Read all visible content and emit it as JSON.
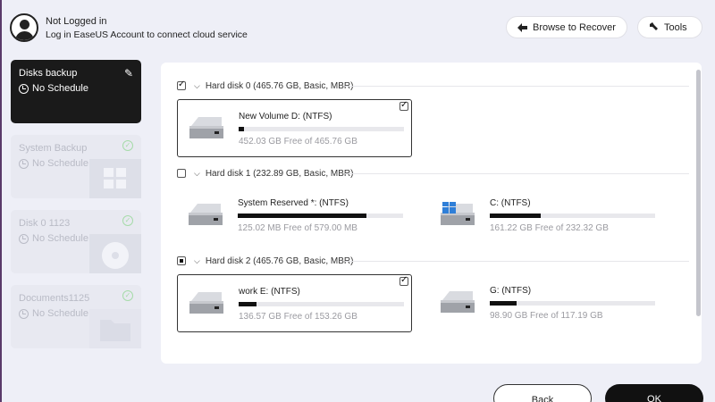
{
  "account": {
    "title": "Not Logged in",
    "subtitle": "Log in EaseUS Account to connect cloud service"
  },
  "toolbar": {
    "browse_label": "Browse to Recover",
    "tools_label": "Tools"
  },
  "sidebar": {
    "items": [
      {
        "title": "Disks backup",
        "schedule": "No Schedule",
        "active": true
      },
      {
        "title": "System Backup",
        "schedule": "No Schedule"
      },
      {
        "title": "Disk 0 1123",
        "schedule": "No Schedule"
      },
      {
        "title": "Documents1125",
        "schedule": "No Schedule"
      }
    ]
  },
  "disks": [
    {
      "label": "Hard disk 0 (465.76 GB, Basic, MBR)",
      "state": "checked",
      "partitions": [
        {
          "name": "New Volume D: (NTFS)",
          "free": "452.03 GB Free of 465.76 GB",
          "used_fraction": 0.03,
          "selected": true
        }
      ]
    },
    {
      "label": "Hard disk 1 (232.89 GB, Basic, MBR)",
      "state": "unchecked",
      "partitions": [
        {
          "name": "System Reserved *: (NTFS)",
          "free": "125.02 MB Free of 579.00 MB",
          "used_fraction": 0.78,
          "selected": false
        },
        {
          "name": "C: (NTFS)",
          "free": "161.22 GB Free of 232.32 GB",
          "used_fraction": 0.31,
          "selected": false
        }
      ]
    },
    {
      "label": "Hard disk 2 (465.76 GB, Basic, MBR)",
      "state": "partial",
      "partitions": [
        {
          "name": "work E: (NTFS)",
          "free": "136.57 GB Free of 153.26 GB",
          "used_fraction": 0.11,
          "selected": true
        },
        {
          "name": "G: (NTFS)",
          "free": "98.90 GB Free of 117.19 GB",
          "used_fraction": 0.16,
          "selected": false
        }
      ]
    }
  ],
  "footer": {
    "back_label": "Back",
    "ok_label": "OK"
  }
}
